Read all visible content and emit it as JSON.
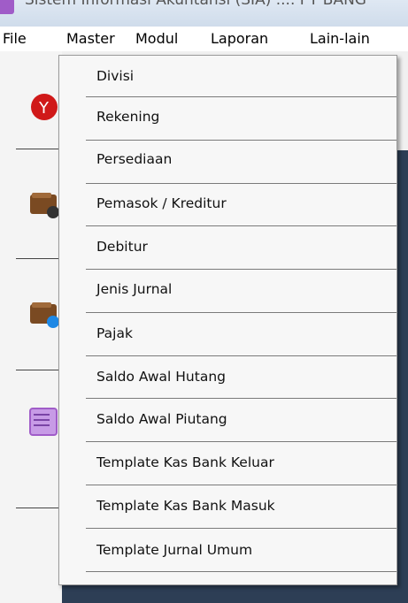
{
  "window": {
    "title": "Sistem Informasi Akuntansi (SIA) .... PT BANG"
  },
  "menubar": {
    "items": [
      "File",
      "Master",
      "Modul",
      "Laporan",
      "Lain-lain"
    ]
  },
  "master_menu": {
    "items": [
      "Divisi",
      "Rekening",
      "Persediaan",
      "Pemasok / Kreditur",
      "Debitur",
      "Jenis Jurnal",
      "Pajak",
      "Saldo Awal Hutang",
      "Saldo Awal Piutang",
      "Template Kas Bank Keluar",
      "Template Kas Bank Masuk",
      "Template Jurnal Umum"
    ]
  },
  "colors": {
    "dark_panel": "#2d3e55",
    "accent_red": "#d01919",
    "accent_blue": "#1e88e5",
    "book_purple": "#a05cc8"
  }
}
